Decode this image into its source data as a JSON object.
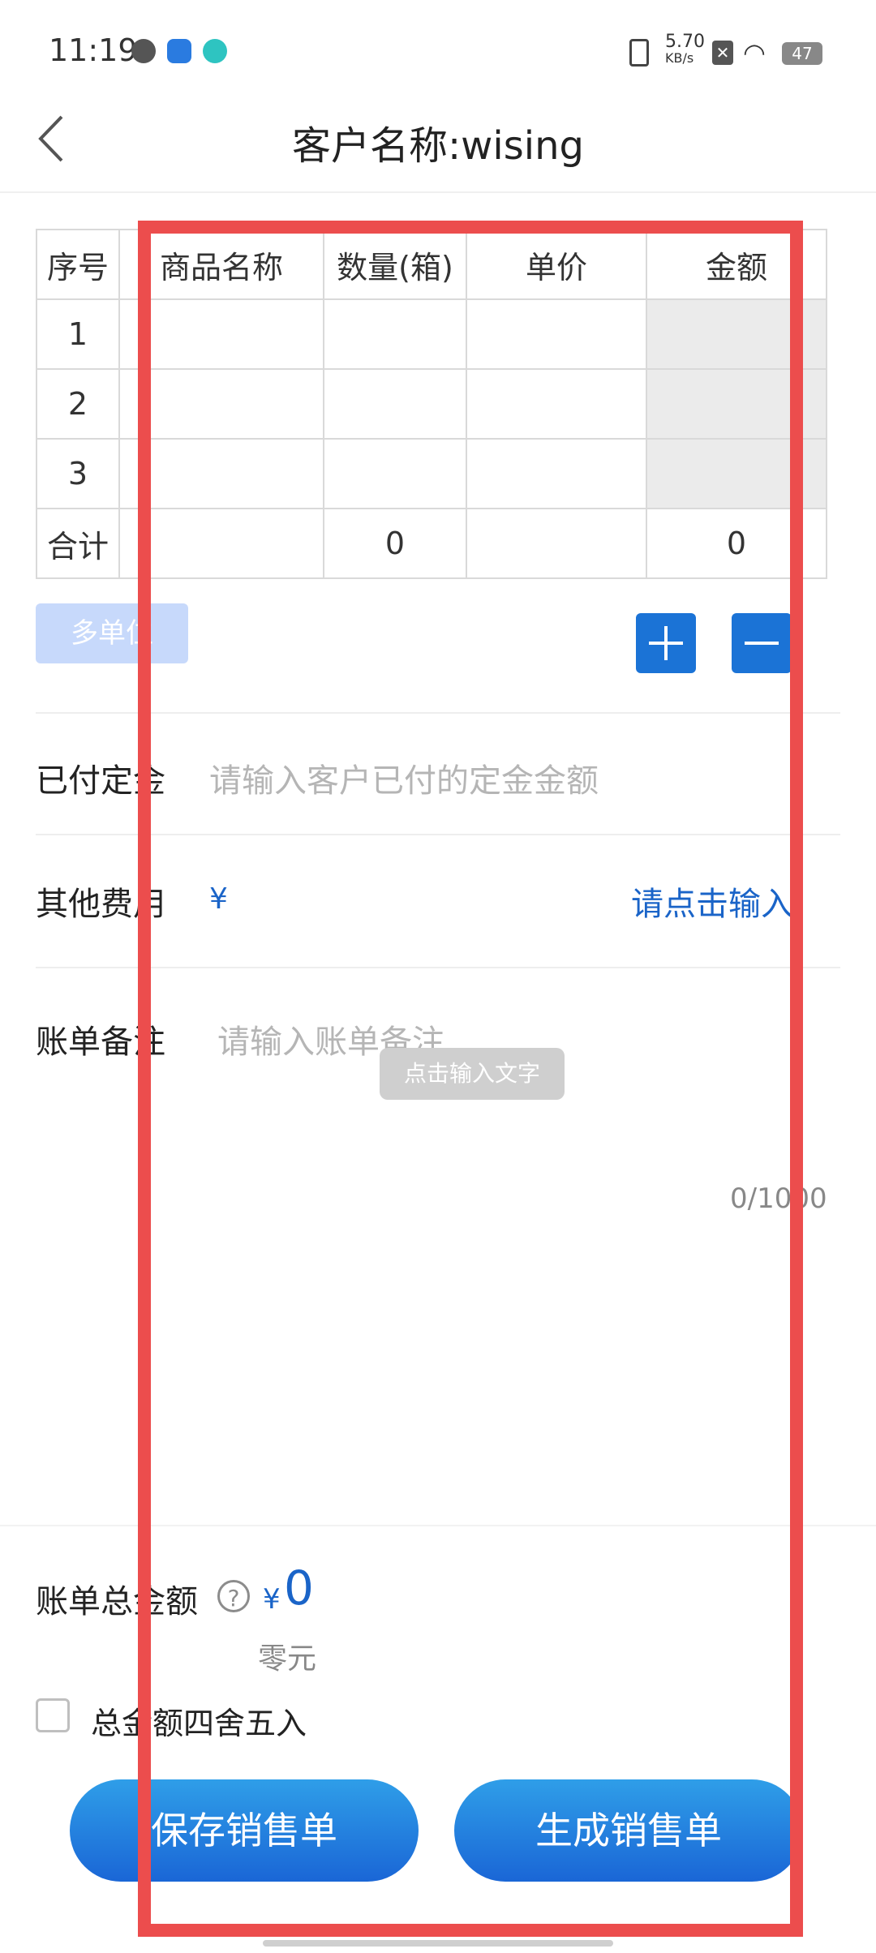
{
  "status_bar": {
    "time": "11:19",
    "net_speed_top": "5.70",
    "net_speed_bottom": "KB/s",
    "battery": "47"
  },
  "header": {
    "title": "客户名称:wising"
  },
  "table": {
    "headers": [
      "序号",
      "商品名称",
      "数量(箱)",
      "单价",
      "金额"
    ],
    "rows": [
      {
        "seq": "1",
        "name": "",
        "qty": "",
        "price": "",
        "amount": ""
      },
      {
        "seq": "2",
        "name": "",
        "qty": "",
        "price": "",
        "amount": ""
      },
      {
        "seq": "3",
        "name": "",
        "qty": "",
        "price": "",
        "amount": ""
      }
    ],
    "total_row": {
      "label": "合计",
      "qty": "0",
      "amount": "0"
    }
  },
  "actions": {
    "multi_unit": "多单位"
  },
  "form": {
    "deposit_label": "已付定金",
    "deposit_placeholder": "请输入客户已付的定金金额",
    "other_fees_label": "其他费用",
    "other_fees_currency": "¥",
    "other_fees_link": "请点击输入",
    "remark_label": "账单备注",
    "remark_placeholder": "请输入账单备注",
    "remark_tooltip": "点击输入文字",
    "remark_counter": "0/1000"
  },
  "summary": {
    "total_label": "账单总金额",
    "help": "?",
    "currency": "¥",
    "total_value": "0",
    "total_words": "零元",
    "round_label": "总金额四舍五入"
  },
  "buttons": {
    "save": "保存销售单",
    "generate": "生成销售单"
  },
  "colors": {
    "accent": "#1a64c8",
    "highlight": "#ec4d4d"
  }
}
